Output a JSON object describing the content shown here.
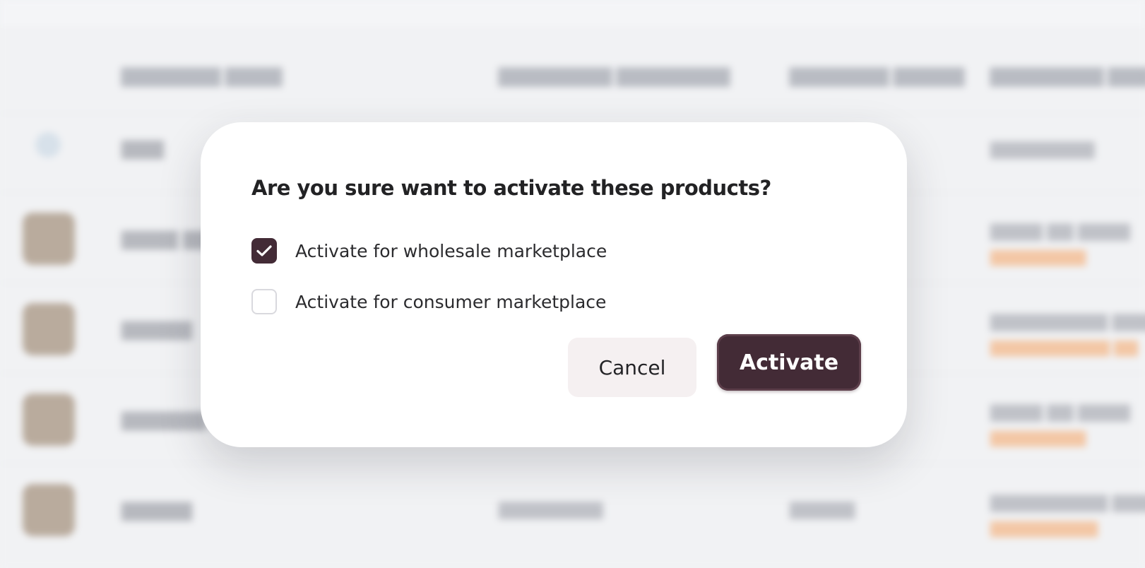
{
  "dialog": {
    "title": "Are you sure want to activate these products?",
    "options": [
      {
        "label": "Activate for wholesale marketplace",
        "checked": true
      },
      {
        "label": "Activate for consumer marketplace",
        "checked": false
      }
    ],
    "cancel_label": "Cancel",
    "activate_label": "Activate"
  },
  "colors": {
    "accent": "#432b36",
    "cancel_bg": "#f5f0f1",
    "backdrop": "#f1f2f4"
  }
}
